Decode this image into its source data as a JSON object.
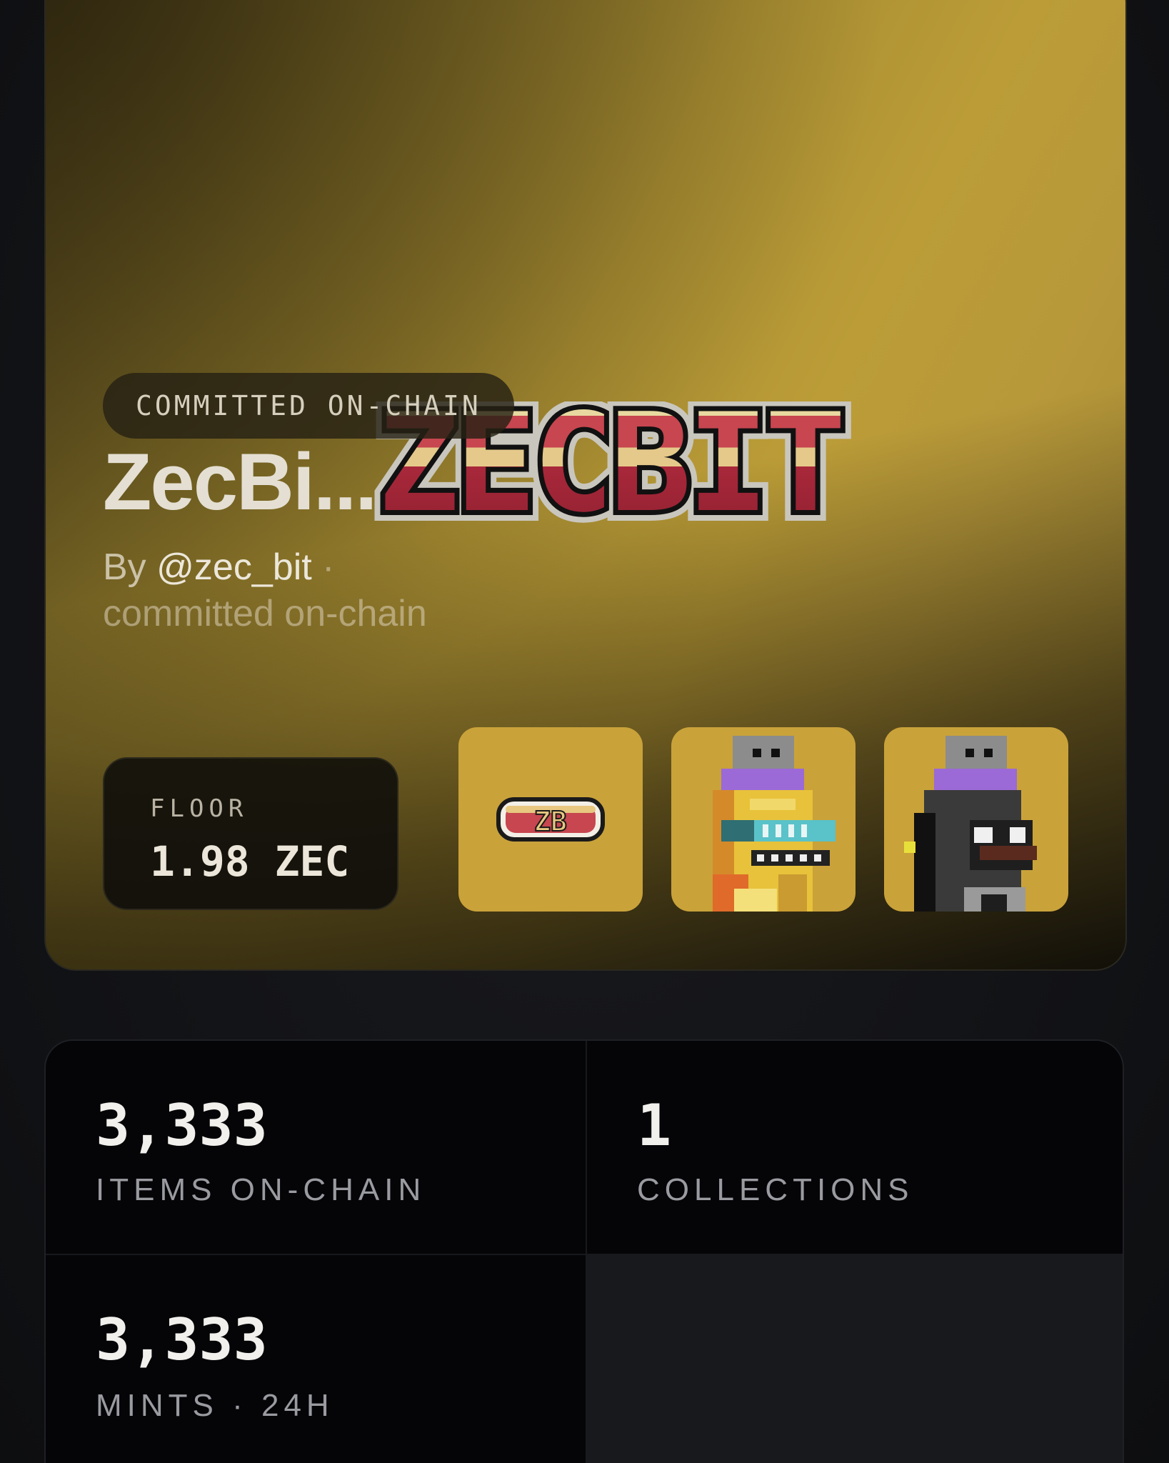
{
  "hero": {
    "badge": "COMMITTED ON-CHAIN",
    "title": "ZecBi...",
    "logo_text": "ZECBIT",
    "byline": {
      "prefix": "By",
      "handle": "@zec_bit",
      "separator": "·",
      "suffix": "committed on-chain"
    },
    "floor": {
      "label": "FLOOR",
      "value": "1.98 ZEC"
    },
    "thumbnails": [
      {
        "name": "zb-logo-thumbnail",
        "badge_text": "ZB"
      },
      {
        "name": "yellow-character-thumbnail"
      },
      {
        "name": "black-character-thumbnail"
      }
    ],
    "colors": {
      "card_gold": "#bb9c37",
      "thumb_bg": "#c9a23a",
      "logo_red": "#a8283a",
      "logo_cream": "#e8d9a0"
    }
  },
  "stats": [
    {
      "value": "3,333",
      "label": "ITEMS ON-CHAIN"
    },
    {
      "value": "1",
      "label": "COLLECTIONS"
    },
    {
      "value": "3,333",
      "label": "MINTS · 24H"
    }
  ]
}
